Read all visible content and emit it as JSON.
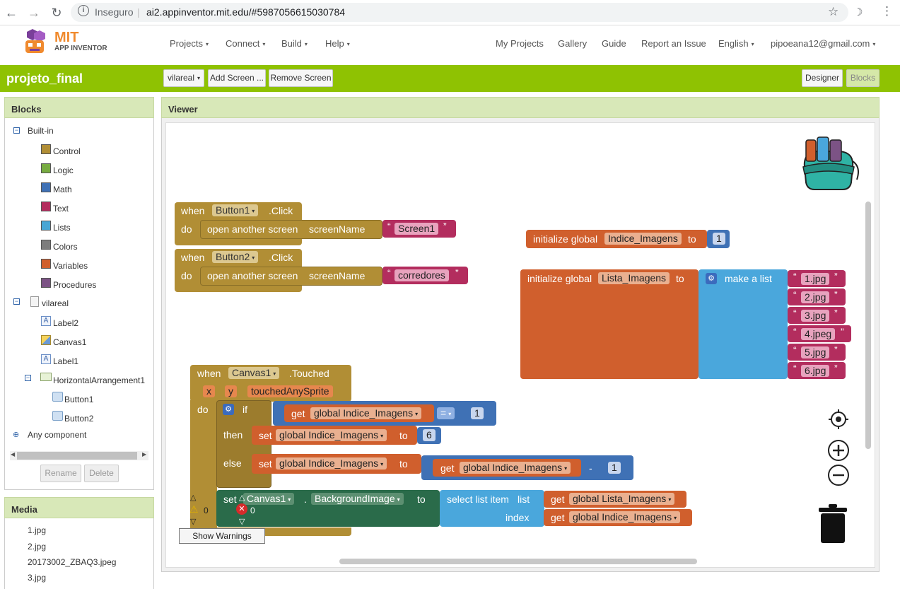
{
  "browser": {
    "security": "Inseguro",
    "url": "ai2.appinventor.mit.edu/#5987056615030784",
    "back_icon": "arrow-left",
    "forward_icon": "arrow-right",
    "reload_icon": "reload"
  },
  "nav": {
    "logo_top": "MIT",
    "logo_bottom": "APP INVENTOR",
    "projects": "Projects",
    "connect": "Connect",
    "build": "Build",
    "help": "Help",
    "my_projects": "My Projects",
    "gallery": "Gallery",
    "guide": "Guide",
    "report": "Report an Issue",
    "language": "English",
    "user": "pipoeana12@gmail.com"
  },
  "project": {
    "name": "projeto_final",
    "screen": "vilareal",
    "add_screen": "Add Screen ...",
    "remove_screen": "Remove Screen",
    "designer": "Designer",
    "blocks": "Blocks"
  },
  "blocks_panel": {
    "title": "Blocks",
    "builtin": "Built-in",
    "categories": [
      {
        "label": "Control",
        "color": "#b18e35"
      },
      {
        "label": "Logic",
        "color": "#77ab41"
      },
      {
        "label": "Math",
        "color": "#3f71b5"
      },
      {
        "label": "Text",
        "color": "#b32d5e"
      },
      {
        "label": "Lists",
        "color": "#49a6d4"
      },
      {
        "label": "Colors",
        "color": "#7d7d7d"
      },
      {
        "label": "Variables",
        "color": "#d05f2d"
      },
      {
        "label": "Procedures",
        "color": "#7c5385"
      }
    ],
    "screen": "vilareal",
    "components": [
      "Label2",
      "Canvas1",
      "Label1",
      "HorizontalArrangement1"
    ],
    "sub_components": [
      "Button1",
      "Button2"
    ],
    "any_component": "Any component",
    "rename": "Rename",
    "delete": "Delete"
  },
  "media": {
    "title": "Media",
    "files": [
      "1.jpg",
      "2.jpg",
      "20173002_ZBAQ3.jpeg",
      "3.jpg"
    ]
  },
  "viewer": {
    "title": "Viewer",
    "warnings_count": "0",
    "errors_count": "0",
    "show_warnings": "Show Warnings"
  },
  "b1": {
    "when": "when",
    "comp": "Button1",
    "event": ".Click",
    "do": "do",
    "action": "open another screen",
    "param": "screenName",
    "value": "Screen1"
  },
  "b2": {
    "when": "when",
    "comp": "Button2",
    "event": ".Click",
    "do": "do",
    "action": "open another screen",
    "param": "screenName",
    "value": "corredores"
  },
  "g1": {
    "init": "initialize global",
    "name": "Indice_Imagens",
    "to": "to",
    "value": "1"
  },
  "g2": {
    "init": "initialize global",
    "name": "Lista_Imagens",
    "to": "to",
    "make": "make a list",
    "items": [
      "1.jpg",
      "2.jpg",
      "3.jpg",
      "4.jpeg",
      "5.jpg",
      "6.jpg"
    ]
  },
  "c": {
    "when": "when",
    "comp": "Canvas1",
    "event": ".Touched",
    "x": "x",
    "y": "y",
    "sprite": "touchedAnySprite",
    "do": "do",
    "if": "if",
    "then": "then",
    "else": "else",
    "get": "get",
    "var_idx": "global Indice_Imagens",
    "eq": "=",
    "one": "1",
    "set": "set",
    "to": "to",
    "six": "6",
    "minus": "-",
    "set_comp": "Canvas1",
    "dot": ".",
    "prop": "BackgroundImage",
    "select": "select list item",
    "list": "list",
    "index": "index",
    "var_list": "global Lista_Imagens"
  },
  "quote_open": "“",
  "quote_close": "”"
}
